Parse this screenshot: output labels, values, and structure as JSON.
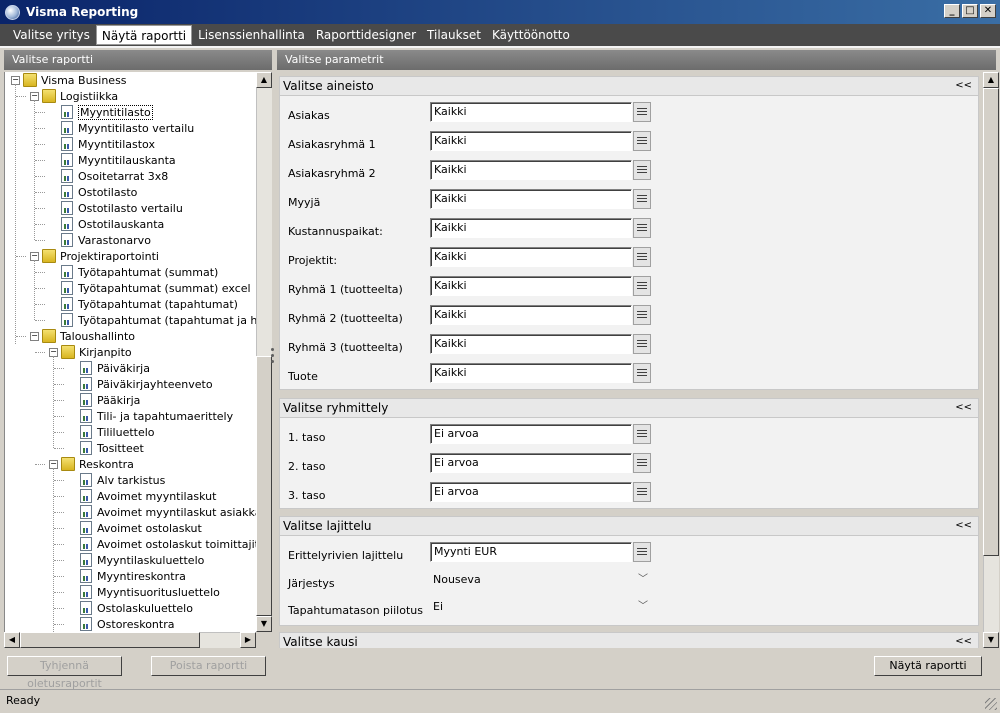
{
  "window": {
    "title": "Visma Reporting",
    "min": "_",
    "max": "□",
    "close": "✕"
  },
  "menu": [
    {
      "label": "Valitse yritys",
      "active": false
    },
    {
      "label": "Näytä raportti",
      "active": true
    },
    {
      "label": "Lisenssienhallinta",
      "active": false
    },
    {
      "label": "Raporttidesigner",
      "active": false
    },
    {
      "label": "Tilaukset",
      "active": false
    },
    {
      "label": "Käyttöönotto",
      "active": false
    }
  ],
  "left": {
    "header": "Valitse raportti",
    "tree": [
      {
        "label": "Visma Business",
        "level": 0,
        "type": "folder"
      },
      {
        "label": "Logistiikka",
        "level": 1,
        "type": "folder"
      },
      {
        "label": "Myyntitilasto",
        "level": 2,
        "type": "report",
        "selected": true
      },
      {
        "label": "Myyntitilasto vertailu",
        "level": 2,
        "type": "report"
      },
      {
        "label": "Myyntitilastox",
        "level": 2,
        "type": "report"
      },
      {
        "label": "Myyntitilauskanta",
        "level": 2,
        "type": "report"
      },
      {
        "label": "Osoitetarrat 3x8",
        "level": 2,
        "type": "report"
      },
      {
        "label": "Ostotilasto",
        "level": 2,
        "type": "report"
      },
      {
        "label": "Ostotilasto vertailu",
        "level": 2,
        "type": "report"
      },
      {
        "label": "Ostotilauskanta",
        "level": 2,
        "type": "report"
      },
      {
        "label": "Varastonarvo",
        "level": 2,
        "type": "report"
      },
      {
        "label": "Projektiraportointi",
        "level": 1,
        "type": "folder"
      },
      {
        "label": "Työtapahtumat (summat)",
        "level": 2,
        "type": "report"
      },
      {
        "label": "Työtapahtumat (summat) excel",
        "level": 2,
        "type": "report"
      },
      {
        "label": "Työtapahtumat (tapahtumat)",
        "level": 2,
        "type": "report"
      },
      {
        "label": "Työtapahtumat (tapahtumat ja hinnat)",
        "level": 2,
        "type": "report"
      },
      {
        "label": "Taloushallinto",
        "level": 1,
        "type": "folder"
      },
      {
        "label": "Kirjanpito",
        "level": 2,
        "type": "folder"
      },
      {
        "label": "Päiväkirja",
        "level": 3,
        "type": "report"
      },
      {
        "label": "Päiväkirjayhteenveto",
        "level": 3,
        "type": "report"
      },
      {
        "label": "Pääkirja",
        "level": 3,
        "type": "report"
      },
      {
        "label": "Tili- ja tapahtumaerittely",
        "level": 3,
        "type": "report"
      },
      {
        "label": "Tililuettelo",
        "level": 3,
        "type": "report"
      },
      {
        "label": "Tositteet",
        "level": 3,
        "type": "report"
      },
      {
        "label": "Reskontra",
        "level": 2,
        "type": "folder"
      },
      {
        "label": "Alv tarkistus",
        "level": 3,
        "type": "report"
      },
      {
        "label": "Avoimet myyntilaskut",
        "level": 3,
        "type": "report"
      },
      {
        "label": "Avoimet myyntilaskut asiakkaittain",
        "level": 3,
        "type": "report"
      },
      {
        "label": "Avoimet ostolaskut",
        "level": 3,
        "type": "report"
      },
      {
        "label": "Avoimet ostolaskut toimittajittain",
        "level": 3,
        "type": "report"
      },
      {
        "label": "Myyntilaskuluettelo",
        "level": 3,
        "type": "report"
      },
      {
        "label": "Myyntireskontra",
        "level": 3,
        "type": "report"
      },
      {
        "label": "Myyntisuoritusluettelo",
        "level": 3,
        "type": "report"
      },
      {
        "label": "Ostolaskuluettelo",
        "level": 3,
        "type": "report"
      },
      {
        "label": "Ostoreskontra",
        "level": 3,
        "type": "report"
      }
    ],
    "clear_default_button": "Tyhjennä oletusraportit",
    "delete_report_button": "Poista raportti"
  },
  "right": {
    "header": "Valitse parametrit",
    "collapse_glyph": "<<",
    "material": {
      "title": "Valitse aineisto",
      "fields": [
        {
          "label": "Asiakas",
          "value": "Kaikki"
        },
        {
          "label": "Asiakasryhmä 1",
          "value": "Kaikki"
        },
        {
          "label": "Asiakasryhmä 2",
          "value": "Kaikki"
        },
        {
          "label": "Myyjä",
          "value": "Kaikki"
        },
        {
          "label": "Kustannuspaikat:",
          "value": "Kaikki"
        },
        {
          "label": "Projektit:",
          "value": "Kaikki"
        },
        {
          "label": "Ryhmä 1 (tuotteelta)",
          "value": "Kaikki"
        },
        {
          "label": "Ryhmä 2 (tuotteelta)",
          "value": "Kaikki"
        },
        {
          "label": "Ryhmä 3 (tuotteelta)",
          "value": "Kaikki"
        },
        {
          "label": "Tuote",
          "value": "Kaikki"
        }
      ]
    },
    "grouping": {
      "title": "Valitse ryhmittely",
      "fields": [
        {
          "label": "1. taso",
          "value": "Ei arvoa"
        },
        {
          "label": "2. taso",
          "value": "Ei arvoa"
        },
        {
          "label": "3. taso",
          "value": "Ei arvoa"
        }
      ]
    },
    "sorting": {
      "title": "Valitse lajittelu",
      "detail_sort_label": "Erittelyrivien lajittelu",
      "detail_sort_value": "Myynti EUR",
      "order_label": "Järjestys",
      "order_value": "Nouseva",
      "hide_label": "Tapahtumatason piilotus",
      "hide_value": "Ei"
    },
    "period": {
      "title": "Valitse kausi"
    },
    "show_report_button": "Näytä raportti"
  },
  "status": {
    "text": "Ready"
  }
}
